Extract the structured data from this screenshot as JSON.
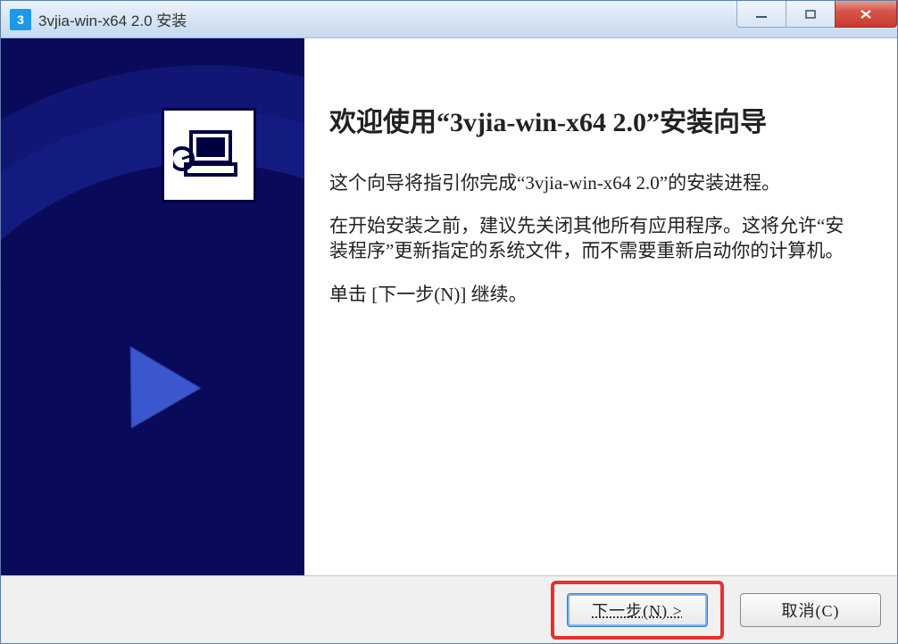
{
  "titlebar": {
    "icon_char": "3",
    "text": "3vjia-win-x64 2.0 安装"
  },
  "content": {
    "heading": "欢迎使用“3vjia-win-x64 2.0”安装向导",
    "para1": "这个向导将指引你完成“3vjia-win-x64 2.0”的安装进程。",
    "para2": "在开始安装之前，建议先关闭其他所有应用程序。这将允许“安装程序”更新指定的系统文件，而不需要重新启动你的计算机。",
    "para3": "单击 [下一步(N)] 继续。"
  },
  "footer": {
    "next_label": "下一步(N) >",
    "cancel_label": "取消(C)"
  }
}
